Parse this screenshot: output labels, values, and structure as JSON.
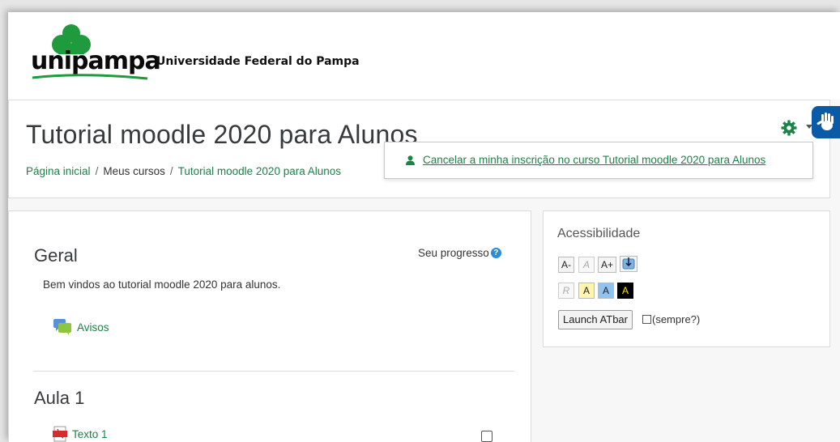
{
  "header": {
    "logo_text": "unipampa",
    "university_name": "Universidade Federal do Pampa"
  },
  "course": {
    "title": "Tutorial moodle 2020 para Alunos",
    "breadcrumb": [
      "Página inicial",
      "Meus cursos",
      "Tutorial moodle 2020 para Alunos"
    ]
  },
  "menu": {
    "unenrol_label": "Cancelar a minha inscrição no curso Tutorial moodle 2020 para Alunos"
  },
  "sections": {
    "general": {
      "title": "Geral",
      "progress_label": "Seu progresso",
      "summary": "Bem vindos ao tutorial moodle 2020 para alunos.",
      "activity": "Avisos"
    },
    "lesson1": {
      "title": "Aula 1",
      "activity": "Texto 1"
    }
  },
  "accessibility": {
    "title": "Acessibilidade",
    "buttons_row1": [
      "A-",
      "A",
      "A+"
    ],
    "buttons_row2": [
      "R",
      "A",
      "A",
      "A"
    ],
    "launch_label": "Launch ATbar",
    "always_label": "(sempre?)"
  },
  "colors": {
    "accent": "#1a8346",
    "logo_green": "#1f9a3c",
    "vlibras_blue": "#0a5aa8"
  },
  "icons": {
    "settings": "gear-icon",
    "user": "user-icon",
    "forum": "forum-icon",
    "pdf": "pdf-icon",
    "help": "help-icon",
    "sign_language": "hand-icon"
  }
}
